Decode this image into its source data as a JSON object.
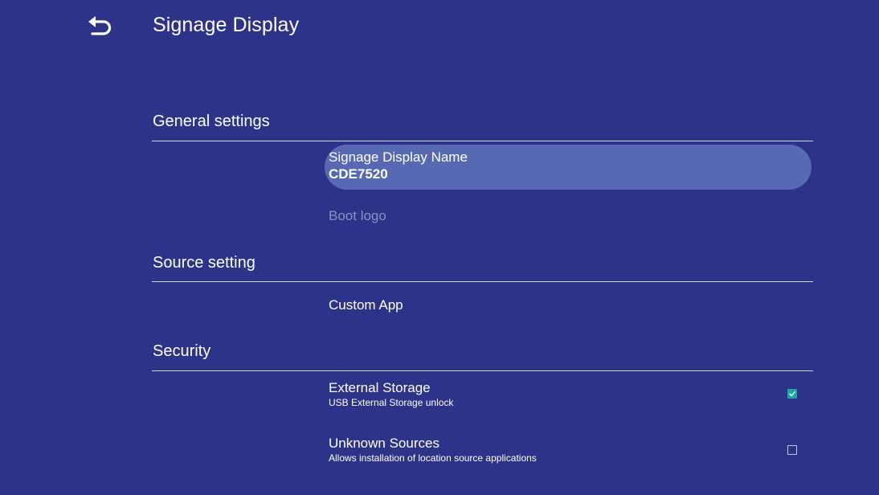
{
  "header": {
    "title": "Signage Display",
    "back_icon": "back-arrow-icon"
  },
  "sections": {
    "general": {
      "label": "General settings",
      "items": [
        {
          "title": "Signage Display Name",
          "value": "CDE7520",
          "selected": true
        },
        {
          "title": "Boot logo",
          "disabled": true
        }
      ]
    },
    "source": {
      "label": "Source setting",
      "items": [
        {
          "title": "Custom App"
        }
      ]
    },
    "security": {
      "label": "Security",
      "items": [
        {
          "title": "External Storage",
          "subtitle": "USB External Storage unlock",
          "checked": true
        },
        {
          "title": "Unknown Sources",
          "subtitle": "Allows installation of location source applications",
          "checked": false
        }
      ]
    }
  },
  "colors": {
    "background": "#2c3388",
    "selected_row": "#5869b4",
    "checkbox_checked": "#1fa6a0",
    "disabled_text": "#8d90c1"
  }
}
